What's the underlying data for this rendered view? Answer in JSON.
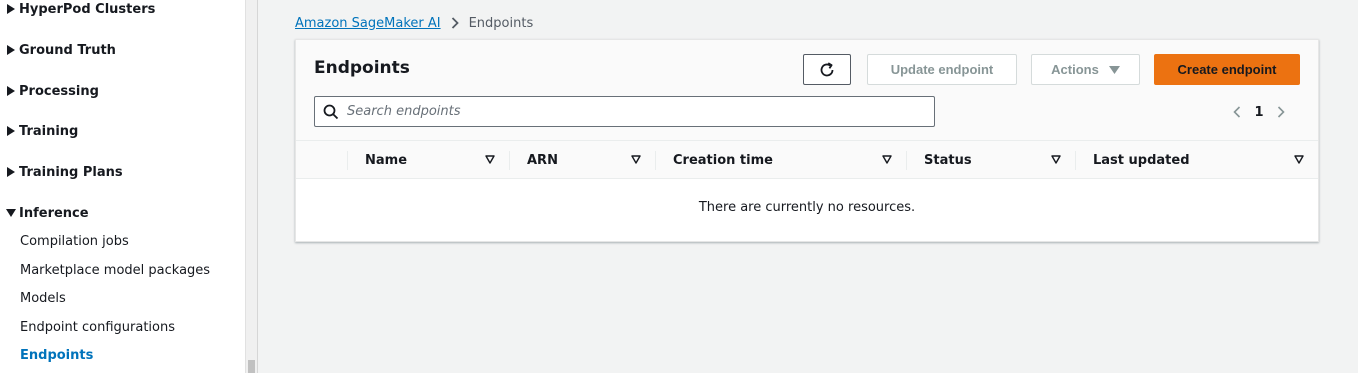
{
  "sidebar": {
    "sections": [
      {
        "label": "HyperPod Clusters",
        "expanded": false
      },
      {
        "label": "Ground Truth",
        "expanded": false
      },
      {
        "label": "Processing",
        "expanded": false
      },
      {
        "label": "Training",
        "expanded": false
      },
      {
        "label": "Training Plans",
        "expanded": false
      },
      {
        "label": "Inference",
        "expanded": true
      }
    ],
    "inference_items": [
      {
        "label": "Compilation jobs"
      },
      {
        "label": "Marketplace model packages"
      },
      {
        "label": "Models"
      },
      {
        "label": "Endpoint configurations"
      },
      {
        "label": "Endpoints",
        "active": true
      }
    ]
  },
  "breadcrumb": {
    "root": "Amazon SageMaker AI",
    "current": "Endpoints"
  },
  "panel": {
    "title": "Endpoints",
    "buttons": {
      "refresh_icon": "refresh-icon",
      "update": "Update endpoint",
      "actions": "Actions",
      "create": "Create endpoint"
    },
    "search": {
      "placeholder": "Search endpoints",
      "value": ""
    },
    "pagination": {
      "current_page": "1"
    },
    "table": {
      "columns": [
        "Name",
        "ARN",
        "Creation time",
        "Status",
        "Last updated"
      ],
      "empty_message": "There are currently no resources."
    }
  },
  "colors": {
    "accent_orange": "#ec7211",
    "link_blue": "#0073bb",
    "background": "#f2f3f3"
  }
}
